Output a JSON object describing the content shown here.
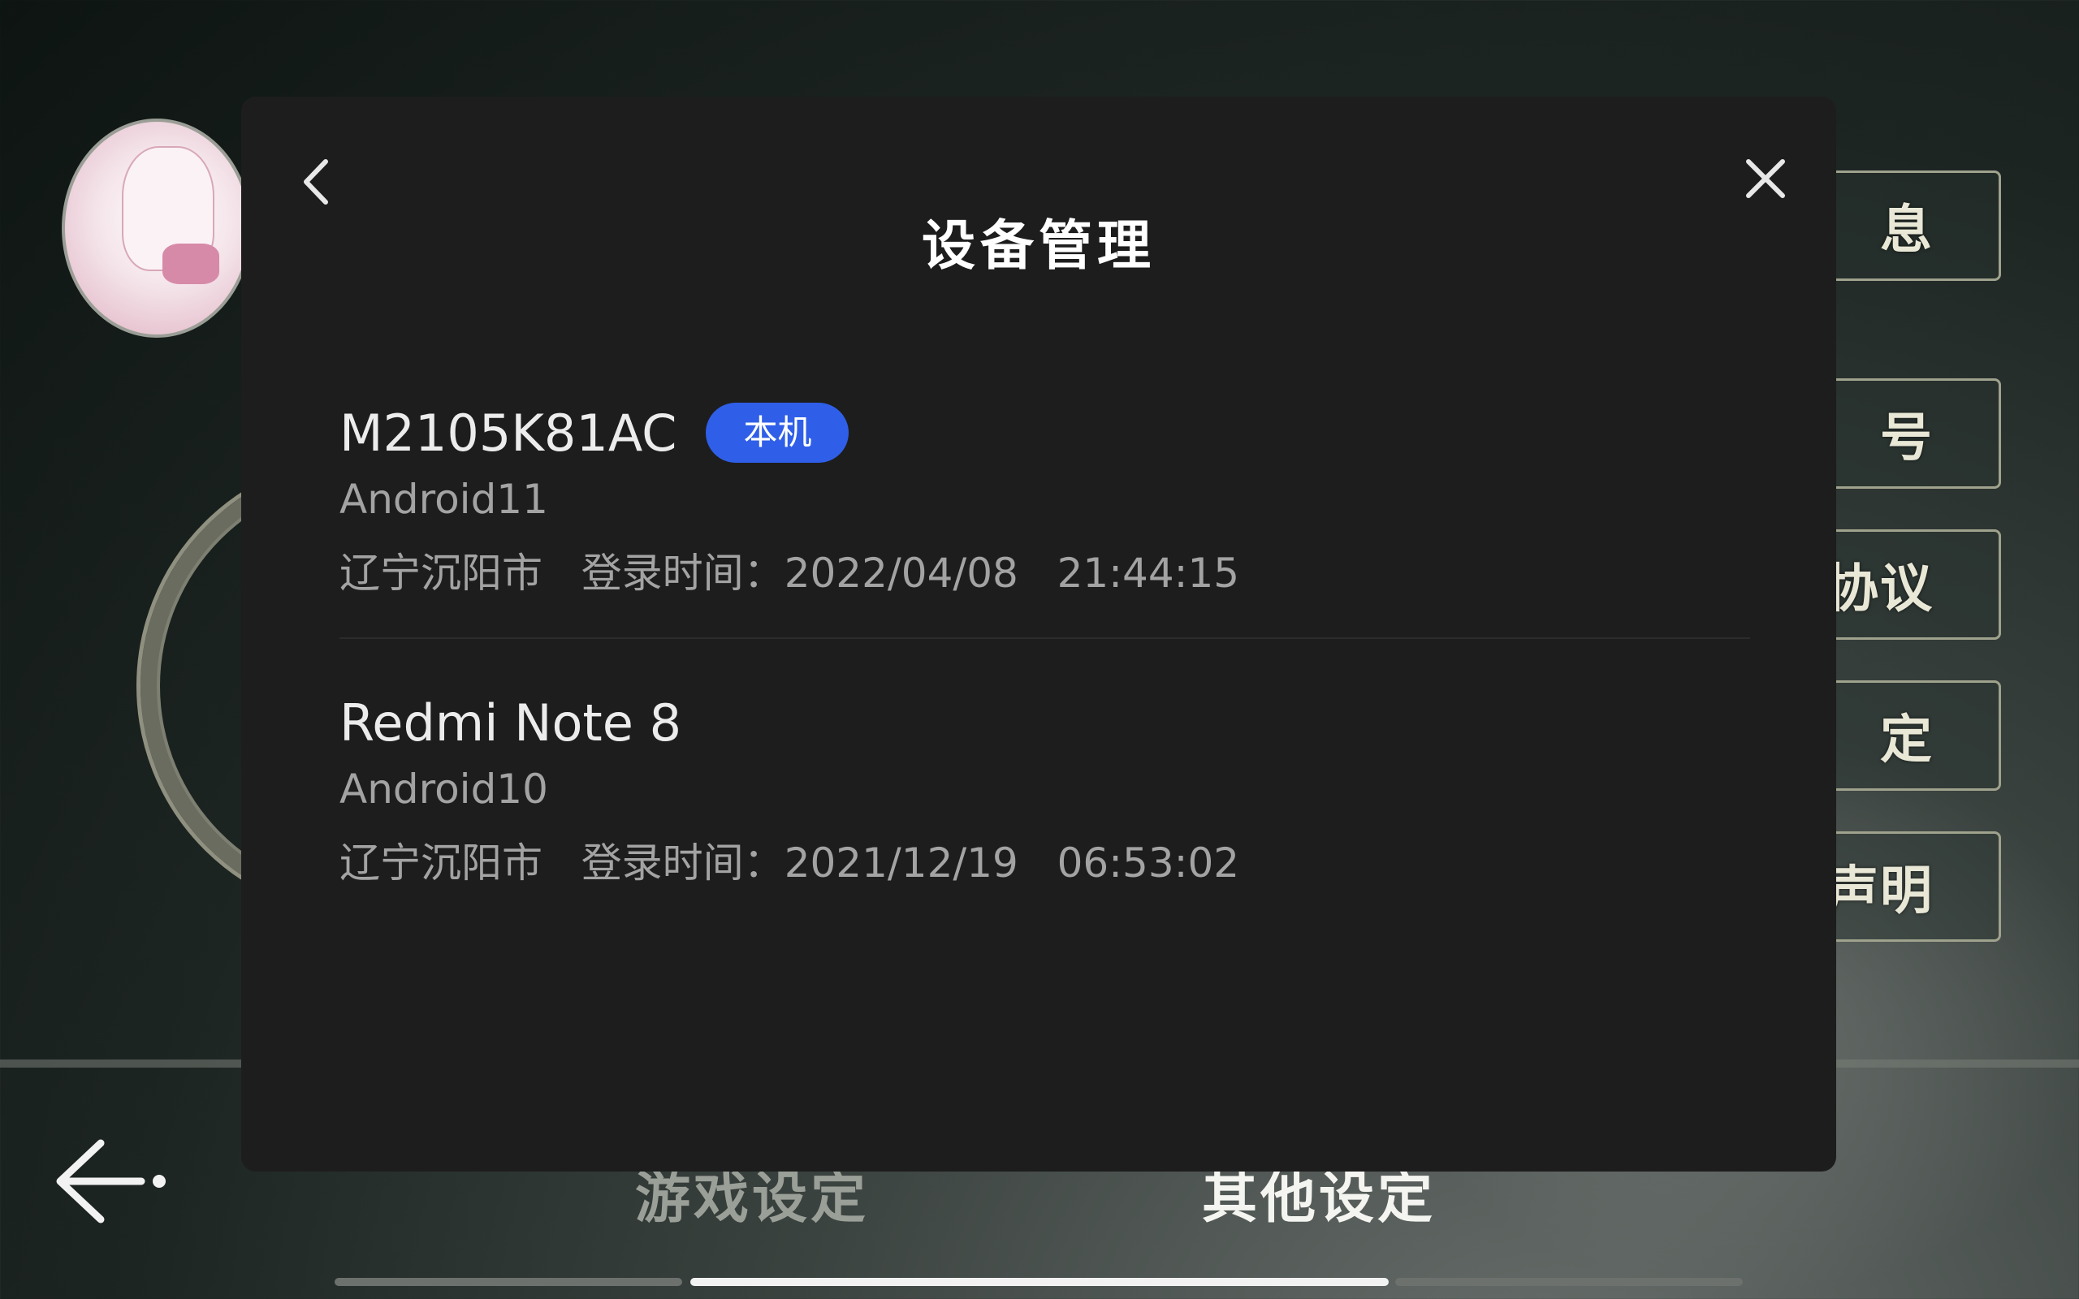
{
  "background": {
    "side_buttons": [
      "息",
      "号",
      "协议",
      "定",
      "声明"
    ],
    "bottom_tabs": [
      {
        "label": "游戏设定",
        "active": false
      },
      {
        "label": "其他设定",
        "active": true
      }
    ],
    "page_indicator_active": 2
  },
  "modal": {
    "title": "设备管理",
    "devices": [
      {
        "name": "M2105K81AC",
        "badge": "本机",
        "os": "Android11",
        "location": "辽宁沉阳市",
        "login_label": "登录时间：",
        "date": "2022/04/08",
        "time": "21:44:15"
      },
      {
        "name": "Redmi Note 8",
        "badge": "",
        "os": "Android10",
        "location": "辽宁沉阳市",
        "login_label": "登录时间：",
        "date": "2021/12/19",
        "time": "06:53:02"
      }
    ]
  },
  "colors": {
    "modal_bg": "#1d1d1d",
    "badge_bg": "#2f5fe8",
    "text_primary": "#ececec",
    "text_secondary": "#a3a3a3"
  },
  "icons": {
    "back": "chevron-left-icon",
    "close": "close-icon",
    "nav_back": "arrow-left-icon"
  }
}
